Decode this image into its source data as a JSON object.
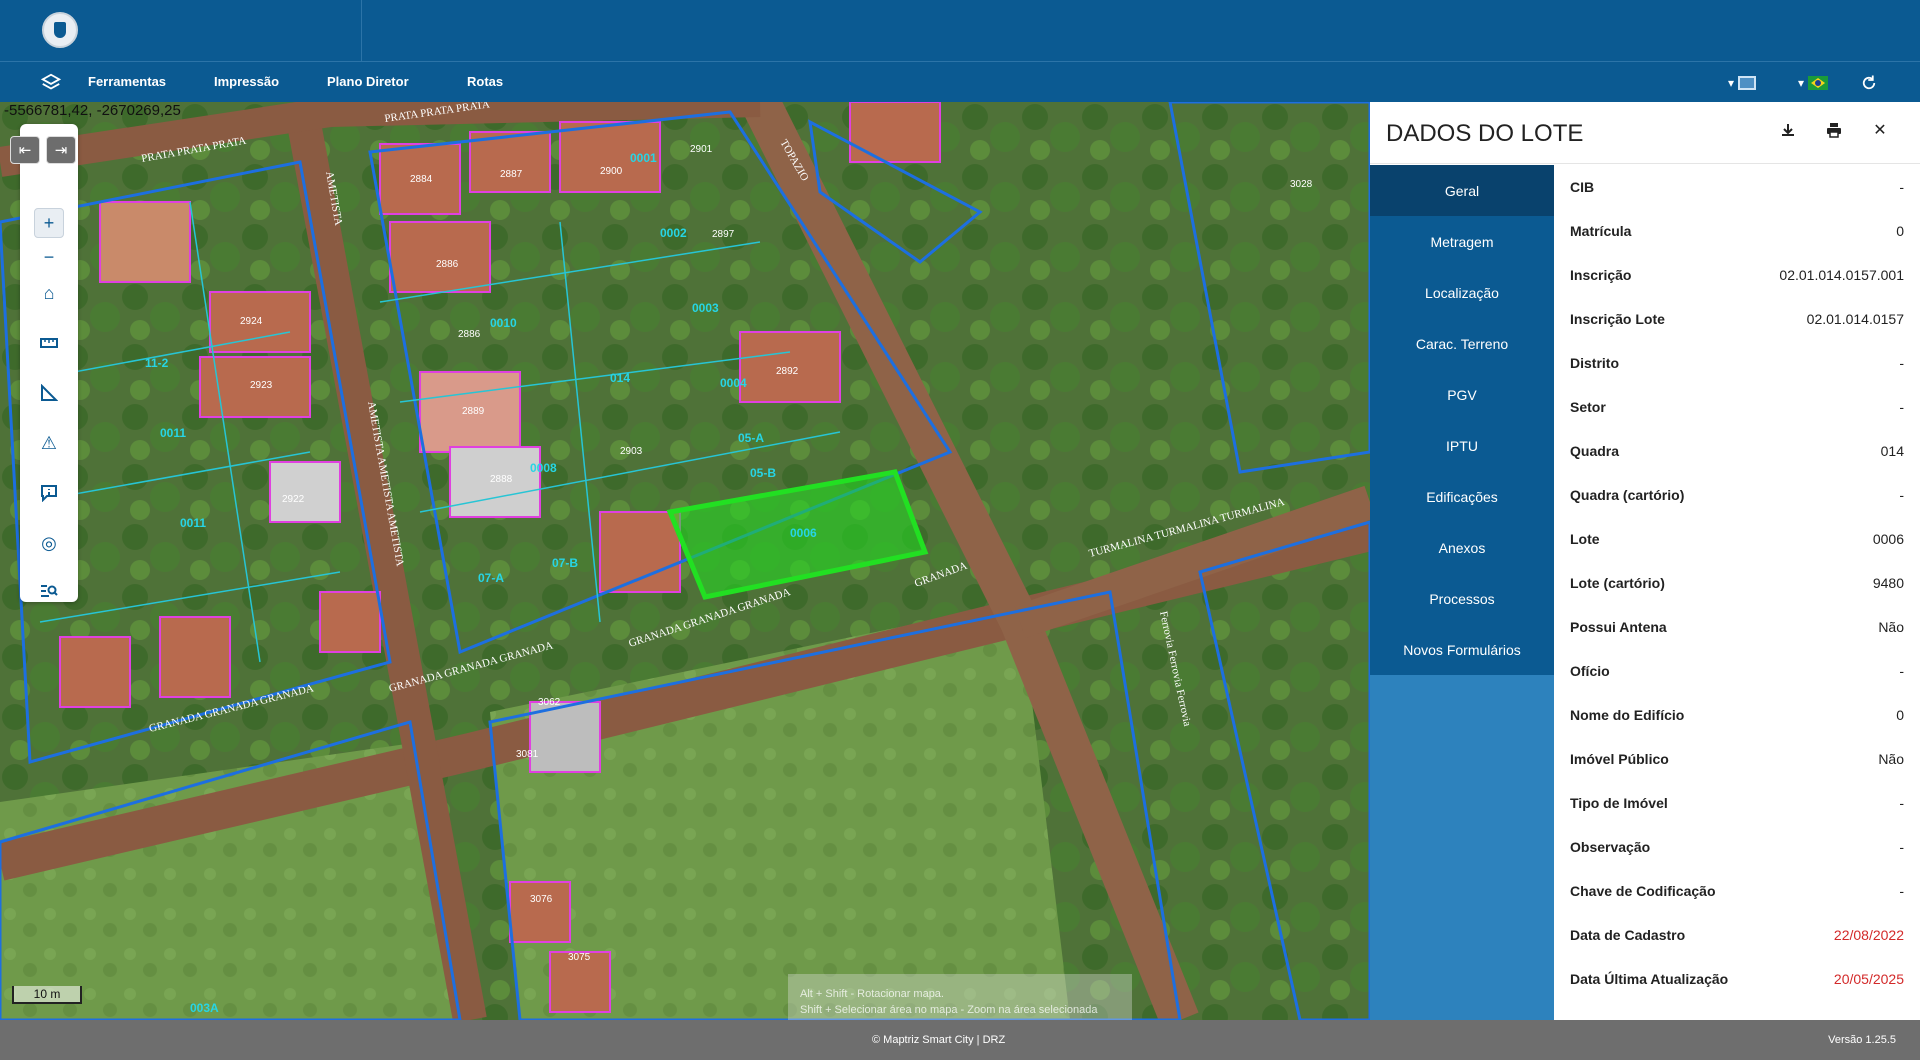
{
  "menu": {
    "items": [
      "Ferramentas",
      "Impressão",
      "Plano Diretor",
      "Rotas"
    ]
  },
  "map": {
    "coords": "-5566781,42, -2670269,25",
    "scale": "10 m",
    "hint_line1": "Alt + Shift - Rotacionar mapa.",
    "hint_line2": "Shift + Selecionar área no mapa - Zoom na área selecionada",
    "labels": [
      "PRATA PRATA PRATA",
      "PRATA PRATA PRATA",
      "AMETISTA",
      "AMETISTA AMETISTA AMETISTA",
      "TOPAZIO",
      "TURMALINA TURMALINA TURMALINA",
      "GRANADA GRANADA GRANADA",
      "GRANADA GRANADA GRANADA",
      "GRANADA GRANADA GRANADA",
      "GRANADA",
      "Ferrovia Ferrovia Ferrovia",
      "014",
      "0001",
      "0002",
      "0003",
      "0004",
      "0006",
      "0008",
      "0010",
      "0011",
      "05-A",
      "05-B",
      "07-A",
      "07-B",
      "11-2",
      "003A",
      "2884",
      "2887",
      "2900",
      "2901",
      "2897",
      "2886",
      "2888",
      "2889",
      "2892",
      "2903",
      "2922",
      "2924",
      "2923",
      "3028",
      "3081",
      "3076",
      "3075",
      "3062"
    ]
  },
  "panel": {
    "title": "DADOS DO LOTE",
    "tabs": [
      "Geral",
      "Metragem",
      "Localização",
      "Carac. Terreno",
      "PGV",
      "IPTU",
      "Edificações",
      "Anexos",
      "Processos",
      "Novos Formulários"
    ],
    "active_tab": "Geral",
    "fields": [
      {
        "label": "CIB",
        "value": "-"
      },
      {
        "label": "Matrícula",
        "value": "0"
      },
      {
        "label": "Inscrição",
        "value": "02.01.014.0157.001"
      },
      {
        "label": "Inscrição Lote",
        "value": "02.01.014.0157"
      },
      {
        "label": "Distrito",
        "value": "-"
      },
      {
        "label": "Setor",
        "value": "-"
      },
      {
        "label": "Quadra",
        "value": "014"
      },
      {
        "label": "Quadra (cartório)",
        "value": "-"
      },
      {
        "label": "Lote",
        "value": "0006"
      },
      {
        "label": "Lote (cartório)",
        "value": "9480"
      },
      {
        "label": "Possui Antena",
        "value": "Não"
      },
      {
        "label": "Ofício",
        "value": "-"
      },
      {
        "label": "Nome do Edifício",
        "value": "0"
      },
      {
        "label": "Imóvel Público",
        "value": "Não"
      },
      {
        "label": "Tipo de Imóvel",
        "value": "-"
      },
      {
        "label": "Observação",
        "value": "-"
      },
      {
        "label": "Chave de Codificação",
        "value": "-"
      },
      {
        "label": "Data de Cadastro",
        "value": "22/08/2022"
      },
      {
        "label": "Data Última Atualização",
        "value": "20/05/2025"
      }
    ],
    "highlight_color": "#d32a2a"
  },
  "footer": {
    "copyright": "© Maptriz Smart City | DRZ",
    "version": "Versão 1.25.5"
  },
  "colors": {
    "primary": "#0b5a92",
    "active_tab": "#09426d",
    "selected_lot": "#22e022",
    "lot_outline": "#e040e0",
    "block_outline": "#1d6fe0"
  },
  "icons": [
    "logo-icon",
    "layers-icon",
    "chevron-down-icon",
    "basemap-icon",
    "flag-br-icon",
    "refresh-icon",
    "download-icon",
    "print-icon",
    "close-icon",
    "zoom-in-icon",
    "zoom-out-icon",
    "home-icon",
    "ruler-icon",
    "angle-icon",
    "warning-icon",
    "info-icon",
    "locate-icon",
    "search-list-icon",
    "nav-back-icon",
    "nav-forward-icon"
  ]
}
